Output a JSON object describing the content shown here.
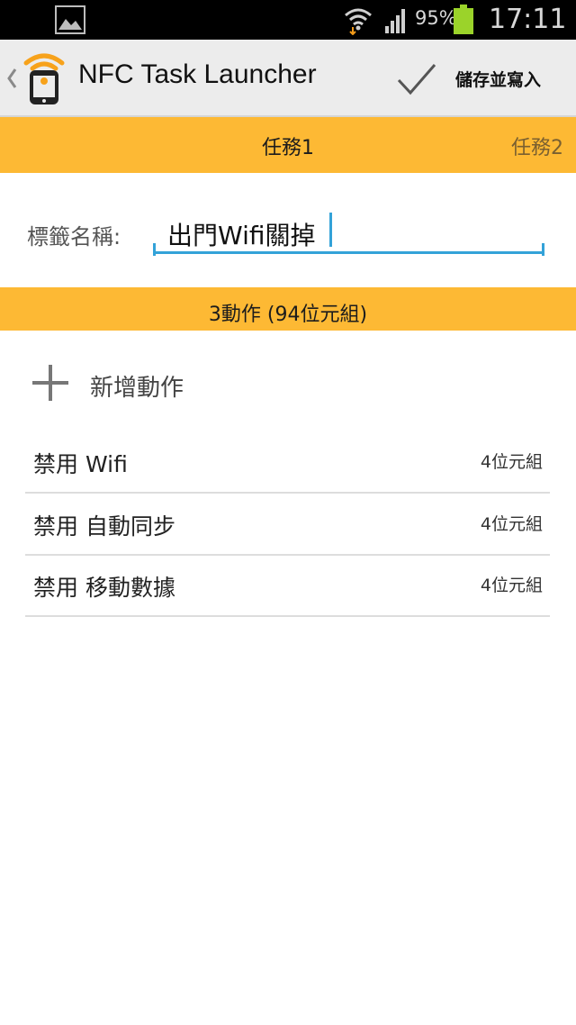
{
  "status_bar": {
    "battery_percent": "95%",
    "time": "17:11",
    "icons": [
      "image-icon",
      "wifi-icon",
      "signal-icon",
      "battery-icon"
    ],
    "battery_color": "#9bd32a"
  },
  "action_bar": {
    "title": "NFC Task Launcher",
    "save_label": "儲存並寫入"
  },
  "tabs": {
    "current": "任務1",
    "next": "任務2"
  },
  "tag": {
    "label": "標籤名稱:",
    "value": "出門Wifi關掉"
  },
  "actions": {
    "header": "3動作 (94位元組)",
    "add_label": "新增動作",
    "items": [
      {
        "name": "禁用 Wifi",
        "size": "4位元組"
      },
      {
        "name": "禁用 自動同步",
        "size": "4位元組"
      },
      {
        "name": "禁用 移動數據",
        "size": "4位元組"
      }
    ]
  },
  "colors": {
    "accent": "#fdb934",
    "input_underline": "#33a2d8",
    "action_bar_bg": "#ececec",
    "logo_orange": "#f7a21b"
  }
}
